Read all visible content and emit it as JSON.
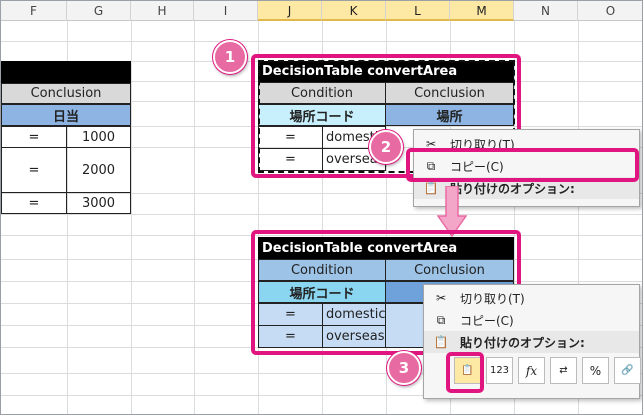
{
  "columns": [
    {
      "letter": "F",
      "selected": false
    },
    {
      "letter": "G",
      "selected": false
    },
    {
      "letter": "H",
      "selected": false
    },
    {
      "letter": "I",
      "selected": false
    },
    {
      "letter": "J",
      "selected": true
    },
    {
      "letter": "K",
      "selected": true
    },
    {
      "letter": "L",
      "selected": true
    },
    {
      "letter": "M",
      "selected": true
    },
    {
      "letter": "N",
      "selected": false
    },
    {
      "letter": "O",
      "selected": false
    }
  ],
  "left_table": {
    "header": "Conclusion",
    "subheader": "日当",
    "rows": [
      {
        "op": "=",
        "value": "1000"
      },
      {
        "op": "=",
        "value": "2000"
      },
      {
        "op": "=",
        "value": "3000"
      }
    ]
  },
  "table_top": {
    "title": "DecisionTable convertArea",
    "condition": "Condition",
    "conclusion": "Conclusion",
    "cond_key": "場所コード",
    "concl_key": "場所",
    "rows": [
      {
        "op": "=",
        "value": "domestic"
      },
      {
        "op": "=",
        "value": "overseas"
      }
    ]
  },
  "table_bottom": {
    "title": "DecisionTable convertArea",
    "condition": "Condition",
    "conclusion": "Conclusion",
    "cond_key": "場所コード",
    "rows": [
      {
        "op": "=",
        "value": "domestic"
      },
      {
        "op": "=",
        "value": "overseas"
      }
    ]
  },
  "menu_top": {
    "cut": "切り取り(T)",
    "copy": "コピー(C)",
    "paste_options": "貼り付けのオプション:"
  },
  "menu_bottom": {
    "cut": "切り取り(T)",
    "copy": "コピー(C)",
    "paste_options": "貼り付けのオプション:",
    "paste_123": "123",
    "paste_fx": "fx",
    "paste_pct": "%"
  },
  "badges": {
    "one": "1",
    "two": "2",
    "three": "3"
  },
  "colors": {
    "accent": "#e0157f",
    "badge": "#e86aa2",
    "header_gray": "#d9d9d9",
    "blue": "#8db4e2",
    "cyan": "#c7f0fc"
  }
}
